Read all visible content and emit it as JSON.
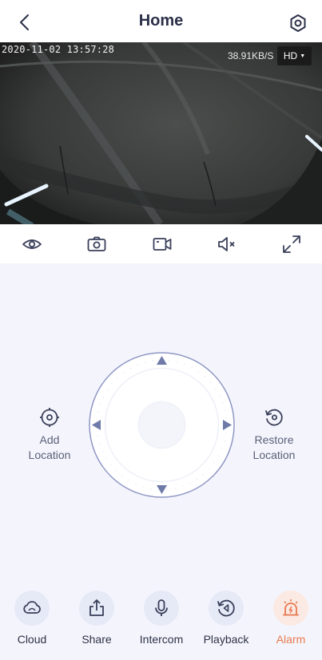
{
  "header": {
    "title": "Home",
    "back_icon": "chevron-left-icon",
    "settings_icon": "hexagon-gear-icon"
  },
  "video": {
    "timestamp": "2020-11-02 13:57:28",
    "bitrate": "38.91KB/S",
    "quality": "HD"
  },
  "toolbar": {
    "items": [
      {
        "icon": "eye-icon"
      },
      {
        "icon": "camera-icon"
      },
      {
        "icon": "video-record-icon"
      },
      {
        "icon": "speaker-muted-icon"
      },
      {
        "icon": "fullscreen-icon"
      }
    ]
  },
  "controls": {
    "add_location": "Add\nLocation",
    "restore_location": "Restore\nLocation"
  },
  "bottom": {
    "items": [
      {
        "label": "Cloud",
        "icon": "cloud-icon"
      },
      {
        "label": "Share",
        "icon": "share-icon"
      },
      {
        "label": "Intercom",
        "icon": "microphone-icon"
      },
      {
        "label": "Playback",
        "icon": "playback-icon"
      },
      {
        "label": "Alarm",
        "icon": "alarm-icon"
      }
    ]
  },
  "colors": {
    "accent": "#6f7aa8",
    "alarm": "#e8794f",
    "background": "#f4f5fc"
  }
}
